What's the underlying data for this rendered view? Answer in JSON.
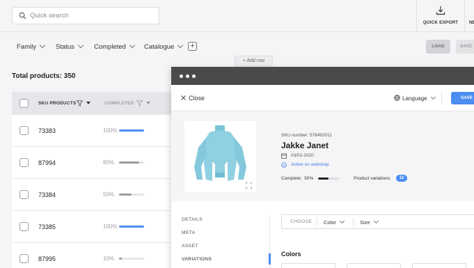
{
  "search": {
    "placeholder": "Quick search"
  },
  "toolbar": {
    "quick_export": "QUICK EXPORT",
    "next_label": "NE"
  },
  "filters": [
    {
      "label": "Family"
    },
    {
      "label": "Status"
    },
    {
      "label": "Completed"
    },
    {
      "label": "Catalogue"
    }
  ],
  "actions": {
    "add": "+",
    "load": "LOAD",
    "save": "SAVE",
    "add_row": "+ Add row"
  },
  "summary": {
    "total": "Total products: 350"
  },
  "table": {
    "headers": {
      "sku": "SKU PRODUCTS",
      "completed": "COMPLETED"
    },
    "rows": [
      {
        "sku": "73383",
        "pct_label": "100%",
        "pct": 100
      },
      {
        "sku": "87994",
        "pct_label": "80%",
        "pct": 80
      },
      {
        "sku": "73384",
        "pct_label": "50%",
        "pct": 50
      },
      {
        "sku": "73385",
        "pct_label": "100%",
        "pct": 100
      },
      {
        "sku": "87995",
        "pct_label": "10%",
        "pct": 10
      }
    ]
  },
  "modal": {
    "close": "Close",
    "language": "Language",
    "save": "SAVE",
    "product": {
      "sku_number": "SKU number:   578492011",
      "name": "Jakke Janet",
      "date": "03/02-2020",
      "status": "Active on webshop",
      "complete_label": "Complete:",
      "complete_value": "50%",
      "complete_pct": 50,
      "variations_label": "Product variations:",
      "variations_count": "12"
    },
    "nav": [
      "DETAILS",
      "META",
      "ASSET",
      "VARIATIONS"
    ],
    "choose_bar": {
      "choose": "CHOOSE",
      "color": "Color",
      "size": "Size"
    },
    "colors_heading": "Colors"
  },
  "colors": {
    "accent": "#4a8cf0",
    "bar_full": "#4a8cf0",
    "bar_partial": "#9a9aa2",
    "titlebar": "#4a4a4a"
  }
}
